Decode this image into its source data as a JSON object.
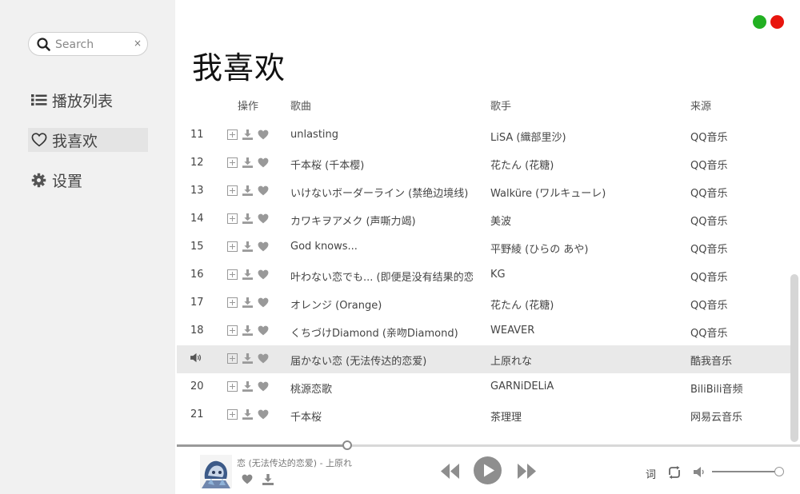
{
  "window": {
    "maximize_color": "#22b022",
    "close_color": "#e8150e"
  },
  "sidebar": {
    "search": {
      "placeholder": "Search",
      "value": "",
      "clear_label": "×"
    },
    "items": [
      {
        "label": "播放列表",
        "icon": "list-icon",
        "active": false
      },
      {
        "label": "我喜欢",
        "icon": "heart-outline-icon",
        "active": true
      },
      {
        "label": "设置",
        "icon": "gear-icon",
        "active": false
      }
    ]
  },
  "page": {
    "title": "我喜欢"
  },
  "table": {
    "headers": {
      "ops": "操作",
      "song": "歌曲",
      "artist": "歌手",
      "source": "来源"
    },
    "rows": [
      {
        "index": "11",
        "song": "unlasting",
        "artist": "LiSA (織部里沙)",
        "source": "QQ音乐",
        "playing": false
      },
      {
        "index": "12",
        "song": "千本桜 (千本樱)",
        "artist": "花たん (花糖)",
        "source": "QQ音乐",
        "playing": false
      },
      {
        "index": "13",
        "song": "いけないボーダーライン (禁绝边境线)",
        "artist": "Walküre (ワルキューレ)",
        "source": "QQ音乐",
        "playing": false
      },
      {
        "index": "14",
        "song": "カワキヲアメク (声嘶力竭)",
        "artist": "美波",
        "source": "QQ音乐",
        "playing": false
      },
      {
        "index": "15",
        "song": "God knows...",
        "artist": "平野綾 (ひらの あや)",
        "source": "QQ音乐",
        "playing": false
      },
      {
        "index": "16",
        "song": "叶わない恋でも... (即便是没有结果的恋",
        "artist": "KG",
        "source": "QQ音乐",
        "playing": false
      },
      {
        "index": "17",
        "song": "オレンジ (Orange)",
        "artist": "花たん (花糖)",
        "source": "QQ音乐",
        "playing": false
      },
      {
        "index": "18",
        "song": "くちづけDiamond (亲吻Diamond)",
        "artist": "WEAVER",
        "source": "QQ音乐",
        "playing": false
      },
      {
        "index": "",
        "song": "届かない恋 (无法传达的恋爱)",
        "artist": "上原れな",
        "source": "酷我音乐",
        "playing": true
      },
      {
        "index": "20",
        "song": "桃源恋歌",
        "artist": "GARNiDELiA",
        "source": "BiliBili音频",
        "playing": false
      },
      {
        "index": "21",
        "song": "千本桜",
        "artist": "茶理理",
        "source": "网易云音乐",
        "playing": false
      }
    ]
  },
  "player": {
    "now_playing": "恋 (无法传达的恋爱) - 上原れ",
    "progress": 0.275,
    "lyric_label": "词",
    "volume": 1.0
  }
}
